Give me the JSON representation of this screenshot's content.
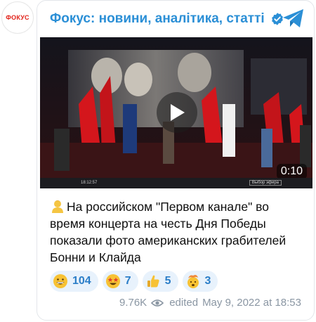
{
  "avatar": {
    "text": "ФОКУС"
  },
  "header": {
    "title": "Фокус: новини, аналітика, статті"
  },
  "media": {
    "duration": "0:10",
    "player_time": "18:12:57",
    "broadcast_label": "Выбор эфира"
  },
  "message": {
    "text": "На российском \"Первом канале\" во время концерта на честь Дня Победы показали фото американских грабителей Бонни и Клайда"
  },
  "reactions": [
    {
      "emoji": "grinning-face",
      "count": "104"
    },
    {
      "emoji": "star-struck-face",
      "count": "7"
    },
    {
      "emoji": "thumbs-up",
      "count": "5"
    },
    {
      "emoji": "exploding-head",
      "count": "3"
    }
  ],
  "footer": {
    "views": "9.76K",
    "edited_label": "edited",
    "date": "May 9, 2022 at 18:53"
  },
  "colors": {
    "accent": "#2b8fd6",
    "reaction_bg": "#e8f2fc",
    "meta": "#8a96a3"
  }
}
